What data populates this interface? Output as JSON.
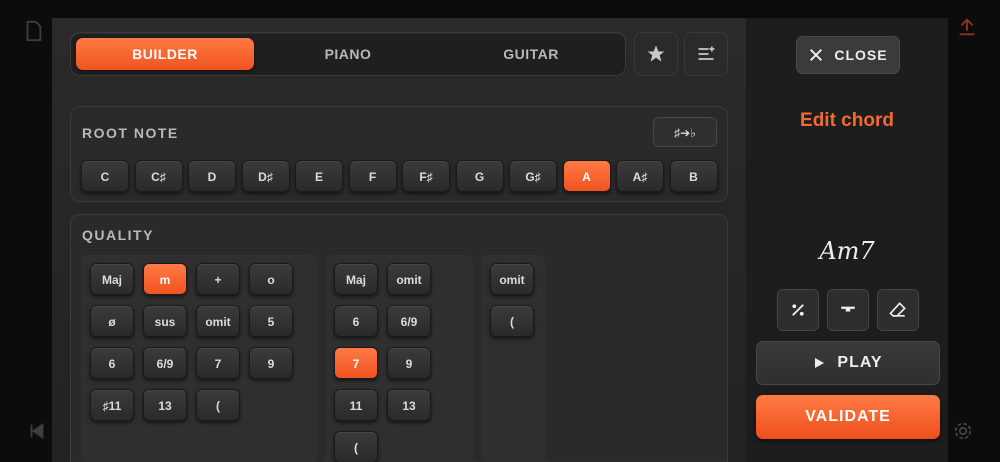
{
  "tabs": [
    {
      "label": "BUILDER",
      "active": true
    },
    {
      "label": "PIANO",
      "active": false
    },
    {
      "label": "GUITAR",
      "active": false
    }
  ],
  "root_note": {
    "title": "ROOT NOTE",
    "toggle_label": "♯➔♭",
    "notes": [
      "C",
      "C♯",
      "D",
      "D♯",
      "E",
      "F",
      "F♯",
      "G",
      "G♯",
      "A",
      "A♯",
      "B"
    ],
    "selected": "A"
  },
  "quality": {
    "title": "QUALITY",
    "column1": [
      "Maj",
      "m",
      "+",
      "o",
      "ø",
      "sus",
      "omit",
      "5",
      "6",
      "6/9",
      "7",
      "9",
      "♯11",
      "13",
      "("
    ],
    "column2": [
      "Maj",
      "omit",
      "6",
      "6/9",
      "7",
      "9",
      "11",
      "13",
      "("
    ],
    "column3": [
      "omit",
      "("
    ],
    "selected_col1": "m",
    "selected_col2": "7"
  },
  "side": {
    "close_label": "CLOSE",
    "edit_title": "Edit chord",
    "chord_name": "Am7",
    "play_label": "PLAY",
    "validate_label": "VALIDATE"
  },
  "colors": {
    "accent": "#f26a32",
    "background": "#222222"
  },
  "icons": [
    "star-icon",
    "playlist-add-icon",
    "close-icon",
    "percent-icon",
    "minus-icon",
    "eraser-icon",
    "play-icon",
    "settings-icon",
    "skip-back-icon",
    "upload-icon",
    "file-icon"
  ]
}
